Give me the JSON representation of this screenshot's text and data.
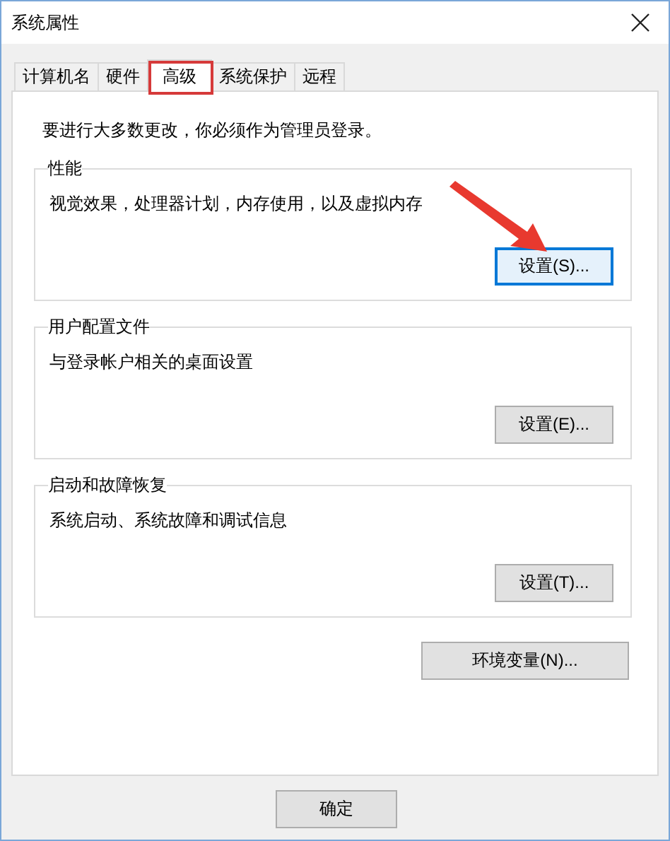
{
  "window": {
    "title": "系统属性"
  },
  "tabs": [
    {
      "label": "计算机名",
      "selected": false
    },
    {
      "label": "硬件",
      "selected": false
    },
    {
      "label": "高级",
      "selected": true
    },
    {
      "label": "系统保护",
      "selected": false
    },
    {
      "label": "远程",
      "selected": false
    }
  ],
  "notice": "要进行大多数更改，你必须作为管理员登录。",
  "groups": [
    {
      "title": "性能",
      "description": "视觉效果，处理器计划，内存使用，以及虚拟内存",
      "button": {
        "label": "设置(S)...",
        "focused": true
      }
    },
    {
      "title": "用户配置文件",
      "description": "与登录帐户相关的桌面设置",
      "button": {
        "label": "设置(E)...",
        "focused": false
      }
    },
    {
      "title": "启动和故障恢复",
      "description": "系统启动、系统故障和调试信息",
      "button": {
        "label": "设置(T)...",
        "focused": false
      }
    }
  ],
  "env_button": "环境变量(N)...",
  "buttons": [
    "确定"
  ]
}
